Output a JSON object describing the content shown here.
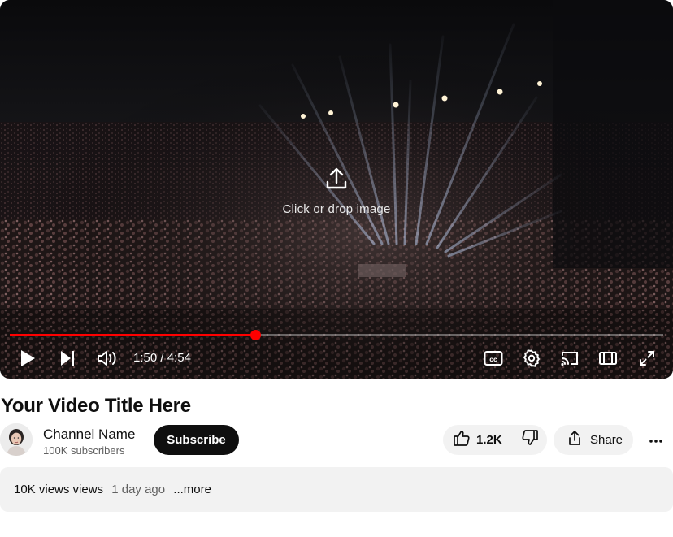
{
  "player": {
    "upload_label": "Click or drop image",
    "time": {
      "current": "1:50",
      "separator": " / ",
      "duration": "4:54"
    },
    "progress_fraction": 0.3755,
    "progress_color": "#ff0000",
    "icons": {
      "play": "play-icon",
      "next": "skip-next-icon",
      "volume": "volume-icon",
      "captions": "closed-captions-icon",
      "settings": "gear-icon",
      "cast": "cast-icon",
      "theater": "theater-mode-icon",
      "fullscreen": "fullscreen-icon",
      "upload": "upload-icon"
    }
  },
  "video": {
    "title": "Your Video Title Here"
  },
  "channel": {
    "name": "Channel Name",
    "subscribers": "100K subscribers",
    "subscribe_label": "Subscribe"
  },
  "actions": {
    "like_count": "1.2K",
    "share_label": "Share"
  },
  "description": {
    "views": "10K views views",
    "time_ago": "1 day ago",
    "more": "...more"
  }
}
